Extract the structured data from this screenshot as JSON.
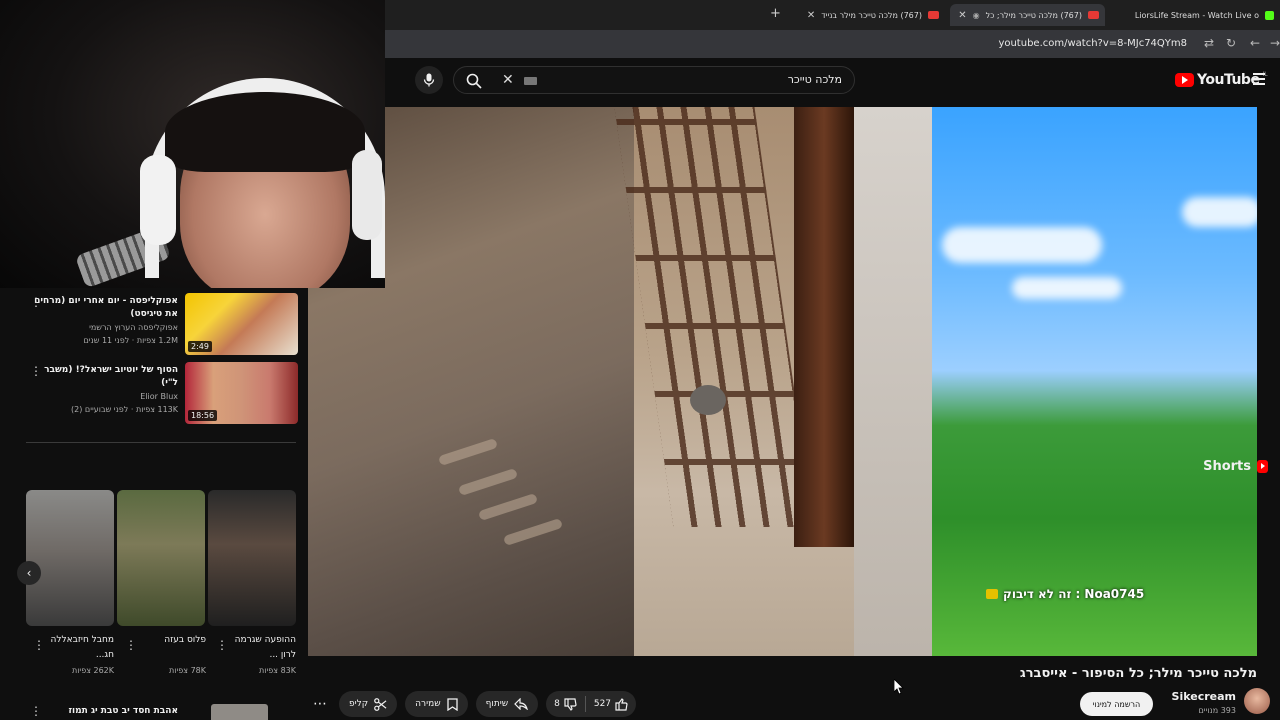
{
  "browser": {
    "tabs": [
      {
        "title": "LiorsLife Stream - Watch Live o",
        "active": false
      },
      {
        "title": "(767) מלכה טייכר מילר; כל",
        "active": true
      },
      {
        "title": "(767) מלכה טייכר מילר בנייד",
        "active": false
      }
    ],
    "url": "youtube.com/watch?v=8-MJc74QYm8"
  },
  "masthead": {
    "logo_text": "YouTube",
    "search_query": "מלכה טייכר"
  },
  "player": {
    "chat_overlay": "Noa0745 : זה לא דיבוק"
  },
  "video": {
    "title": "מלכה טייכר מילר; כל הסיפור - אייסברג",
    "channel": "Sikecream",
    "subscribers": "393 מנויים",
    "join_label": "הרשמה למינוי",
    "likes": "527",
    "dislikes": "8",
    "share_label": "שיתוף",
    "save_label": "שמירה",
    "clip_label": "קליפ"
  },
  "related": [
    {
      "title": "אפוקליפסה - יום אחרי יום (מרחים את טיגיסט)",
      "channel": "אפוקליפסה הערוץ הרשמי",
      "meta": "1.2M צפיות · לפני 11 שנים",
      "duration": "2:49"
    },
    {
      "title": "הסוף של יוטיוב ישראל?! (משבר ל\"י)",
      "channel": "Elior Blux",
      "meta": "113K צפיות · לפני שבועיים (2)",
      "duration": "18:56"
    }
  ],
  "shorts": {
    "heading": "Shorts",
    "items": [
      {
        "title": "ההופעה שגרמה לרון ...",
        "views": "83K צפיות"
      },
      {
        "title": "פלוס בעזה",
        "views": "78K צפיות"
      },
      {
        "title": "מחבל חיזבאללה חג...",
        "views": "262K צפיות"
      }
    ]
  },
  "bottom_related": {
    "title": "אהבת חסד יב טבת יג תמוז"
  },
  "colors": {
    "accent": "#ff0000",
    "background": "#0f0f0f",
    "chip": "#272727"
  },
  "icons": [
    "mic-icon",
    "search-icon",
    "clear-icon",
    "menu-icon",
    "like-icon",
    "dislike-icon",
    "share-icon",
    "save-icon",
    "clip-icon",
    "more-icon",
    "chevron-left-icon"
  ]
}
